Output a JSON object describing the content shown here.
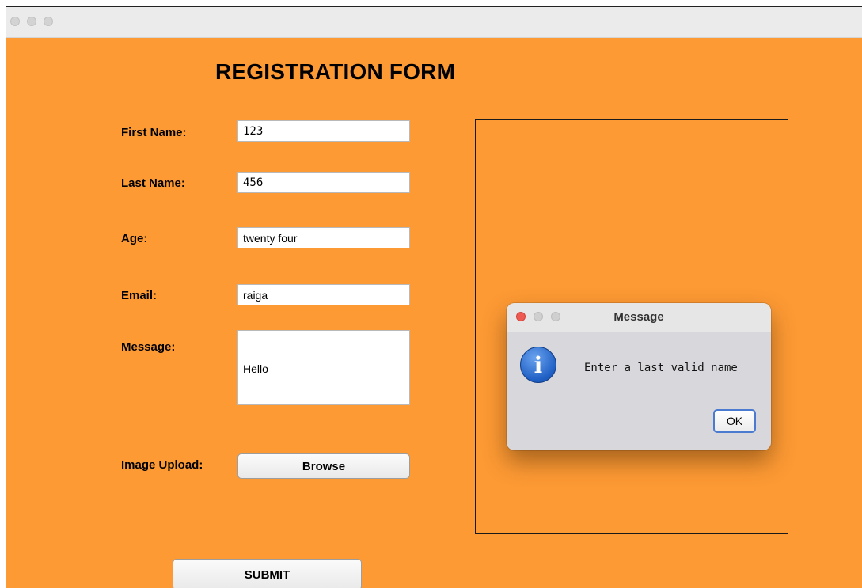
{
  "window": {
    "title": ""
  },
  "form": {
    "title": "REGISTRATION FORM",
    "first_name": {
      "label": "First Name:",
      "value": "123"
    },
    "last_name": {
      "label": "Last Name:",
      "value": "456"
    },
    "age": {
      "label": "Age:",
      "value": "twenty four"
    },
    "email": {
      "label": "Email:",
      "value": "raiga"
    },
    "message": {
      "label": "Message:",
      "value": "Hello"
    },
    "image_upload": {
      "label": "Image Upload:",
      "button": "Browse"
    },
    "submit_label": "SUBMIT"
  },
  "dialog": {
    "title": "Message",
    "text": "Enter a last valid name",
    "ok_label": "OK",
    "icon": "info-icon"
  },
  "colors": {
    "form_background": "#fd9a34",
    "dialog_background": "#d8d8dc",
    "close_dot": "#ee5a52",
    "info_icon": "#1f5fc4"
  }
}
